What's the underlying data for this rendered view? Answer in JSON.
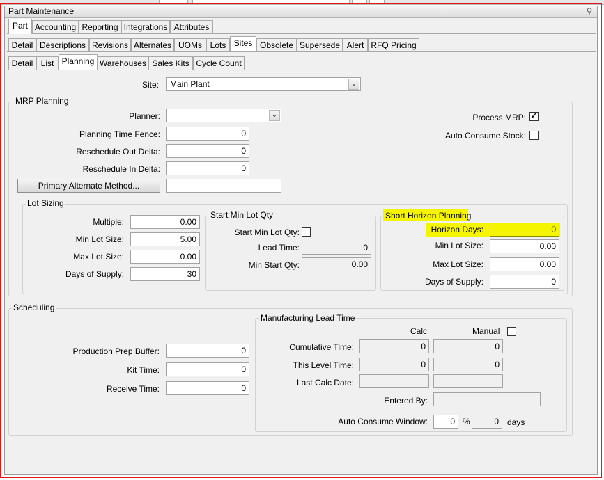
{
  "window": {
    "title": "Part Maintenance"
  },
  "tabs_level1": [
    "Part",
    "Accounting",
    "Reporting",
    "Integrations",
    "Attributes"
  ],
  "tabs_level2": [
    "Detail",
    "Descriptions",
    "Revisions",
    "Alternates",
    "UOMs",
    "Lots",
    "Sites",
    "Obsolete",
    "Supersede",
    "Alert",
    "RFQ Pricing"
  ],
  "tabs_level3": [
    "Detail",
    "List",
    "Planning",
    "Warehouses",
    "Sales Kits",
    "Cycle Count"
  ],
  "site": {
    "label": "Site:",
    "value": "Main Plant"
  },
  "mrp": {
    "title": "MRP Planning",
    "planner_label": "Planner:",
    "planner_value": "",
    "ptf_label": "Planning Time Fence:",
    "ptf_value": "0",
    "rod_label": "Reschedule Out Delta:",
    "rod_value": "0",
    "rid_label": "Reschedule In Delta:",
    "rid_value": "0",
    "pam_button": "Primary Alternate Method...",
    "pam_value": "",
    "process_mrp_label": "Process MRP:",
    "process_mrp_checked": true,
    "auto_consume_label": "Auto Consume Stock:",
    "auto_consume_checked": false
  },
  "lot_sizing": {
    "title": "Lot Sizing",
    "multiple_label": "Multiple:",
    "multiple_value": "0.00",
    "min_label": "Min Lot Size:",
    "min_value": "5.00",
    "max_label": "Max Lot Size:",
    "max_value": "0.00",
    "dos_label": "Days of Supply:",
    "dos_value": "30"
  },
  "start_min": {
    "title": "Start Min Lot Qty",
    "chk_label": "Start Min Lot Qty:",
    "chk_checked": false,
    "lead_label": "Lead Time:",
    "lead_value": "0",
    "msq_label": "Min Start Qty:",
    "msq_value": "0.00"
  },
  "short_horizon": {
    "title": "Short Horizon Planning",
    "hd_label": "Horizon Days:",
    "hd_value": "0",
    "min_label": "Min Lot Size:",
    "min_value": "0.00",
    "max_label": "Max Lot Size:",
    "max_value": "0.00",
    "dos_label": "Days of Supply:",
    "dos_value": "0",
    "highlight_color": "#f5f500"
  },
  "scheduling": {
    "title": "Scheduling",
    "ppb_label": "Production Prep Buffer:",
    "ppb_value": "0",
    "kit_label": "Kit Time:",
    "kit_value": "0",
    "recv_label": "Receive Time:",
    "recv_value": "0"
  },
  "mlt": {
    "title": "Manufacturing Lead Time",
    "calc_header": "Calc",
    "manual_header": "Manual",
    "manual_checked": false,
    "cum_label": "Cumulative Time:",
    "cum_calc": "0",
    "cum_manual": "0",
    "tlt_label": "This Level Time:",
    "tlt_calc": "0",
    "tlt_manual": "0",
    "lcd_label": "Last Calc Date:",
    "lcd_calc": "",
    "lcd_manual": "",
    "eb_label": "Entered By:",
    "eb_value": "",
    "acw_label": "Auto Consume Window:",
    "acw_value": "0",
    "acw_pct_symbol": "%",
    "acw_pct_value": "0",
    "acw_unit": "days"
  }
}
